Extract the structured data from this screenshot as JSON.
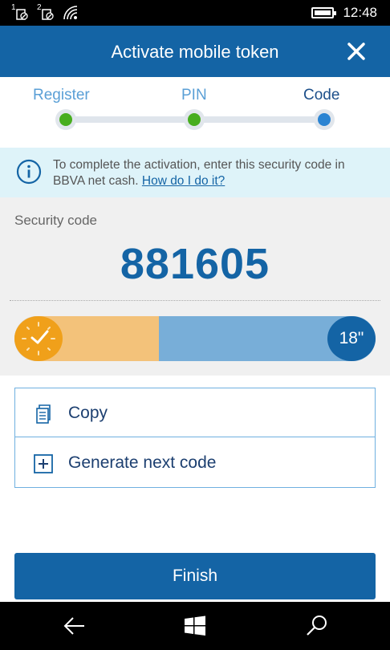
{
  "status_bar": {
    "sim1": "1",
    "sim2": "2",
    "time": "12:48"
  },
  "header": {
    "title": "Activate mobile token",
    "close_icon": "close-icon"
  },
  "stepper": {
    "steps": [
      {
        "label": "Register",
        "state": "done"
      },
      {
        "label": "PIN",
        "state": "done"
      },
      {
        "label": "Code",
        "state": "current"
      }
    ]
  },
  "info": {
    "icon": "info-icon",
    "text": "To complete the activation, enter this security code in BBVA net cash. ",
    "link": "How do I do it?"
  },
  "security": {
    "label": "Security code",
    "code": "881605",
    "seconds_label": "18\"",
    "progress_fraction": 0.4
  },
  "actions": [
    {
      "label": "Copy",
      "icon": "copy-icon"
    },
    {
      "label": "Generate next code",
      "icon": "plus-box-icon"
    }
  ],
  "finish_label": "Finish",
  "colors": {
    "brand_blue": "#1464a5",
    "step_done": "#48ae1f",
    "step_current": "#2b84d2",
    "timer_orange": "#f0a01a",
    "info_bg": "#def3f9"
  }
}
